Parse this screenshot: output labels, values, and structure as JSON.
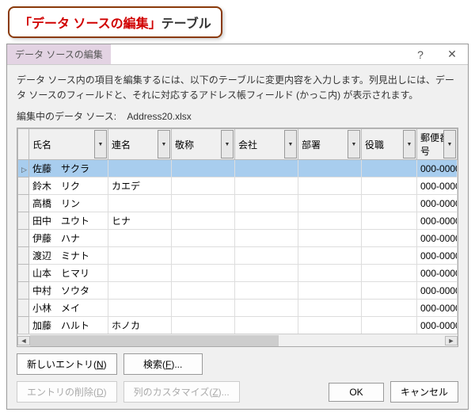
{
  "callout": {
    "red": "「データ ソースの編集」",
    "black": "テーブル"
  },
  "titlebar": {
    "title": "データ ソースの編集",
    "help": "?",
    "close": "✕"
  },
  "desc": "データ ソース内の項目を編集するには、以下のテーブルに変更内容を入力します。列見出しには、データ ソースのフィールドと、それに対応するアドレス帳フィールド (かっこ内) が表示されます。",
  "srcline": {
    "label": "編集中のデータ ソース:",
    "value": "Address20.xlsx"
  },
  "columns": [
    "氏名",
    "連名",
    "敬称",
    "会社",
    "部署",
    "役職",
    "郵便番号"
  ],
  "rows": [
    {
      "sel": true,
      "cells": [
        "佐藤　サクラ",
        "",
        "",
        "",
        "",
        "",
        "000-0000"
      ]
    },
    {
      "sel": false,
      "cells": [
        "鈴木　リク",
        "カエデ",
        "",
        "",
        "",
        "",
        "000-0000"
      ]
    },
    {
      "sel": false,
      "cells": [
        "高橋　リン",
        "",
        "",
        "",
        "",
        "",
        "000-0000"
      ]
    },
    {
      "sel": false,
      "cells": [
        "田中　ユウト",
        "ヒナ",
        "",
        "",
        "",
        "",
        "000-0000"
      ]
    },
    {
      "sel": false,
      "cells": [
        "伊藤　ハナ",
        "",
        "",
        "",
        "",
        "",
        "000-0000"
      ]
    },
    {
      "sel": false,
      "cells": [
        "渡辺　ミナト",
        "",
        "",
        "",
        "",
        "",
        "000-0000"
      ]
    },
    {
      "sel": false,
      "cells": [
        "山本　ヒマリ",
        "",
        "",
        "",
        "",
        "",
        "000-0000"
      ]
    },
    {
      "sel": false,
      "cells": [
        "中村　ソウタ",
        "",
        "",
        "",
        "",
        "",
        "000-0000"
      ]
    },
    {
      "sel": false,
      "cells": [
        "小林　メイ",
        "",
        "",
        "",
        "",
        "",
        "000-0000"
      ]
    },
    {
      "sel": false,
      "cells": [
        "加藤　ハルト",
        "ホノカ",
        "",
        "",
        "",
        "",
        "000-0000"
      ]
    }
  ],
  "buttons": {
    "newEntry": {
      "text": "新しいエントリ(",
      "accel": "N",
      "suffix": ")"
    },
    "find": {
      "text": "検索(",
      "accel": "F",
      "suffix": ")..."
    },
    "delete": {
      "text": "エントリの削除(",
      "accel": "D",
      "suffix": ")"
    },
    "custom": {
      "text": "列のカスタマイズ(",
      "accel": "Z",
      "suffix": ")..."
    },
    "ok": "OK",
    "cancel": "キャンセル"
  }
}
